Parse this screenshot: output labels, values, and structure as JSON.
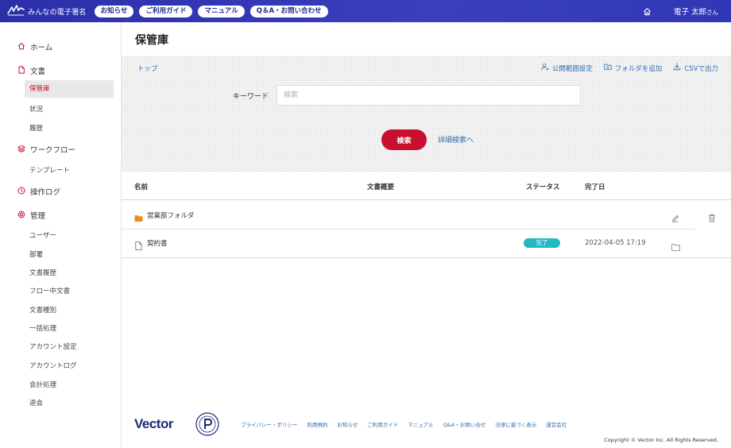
{
  "header": {
    "app_name": "みんなの電子署名",
    "nav": [
      "お知らせ",
      "ご利用ガイド",
      "マニュアル",
      "Q＆A・お問い合わせ"
    ],
    "user_name": "電子 太郎",
    "user_suffix": "さん"
  },
  "sidebar": {
    "home": "ホーム",
    "documents": "文書",
    "documents_sub": [
      "保管庫",
      "状況",
      "履歴"
    ],
    "workflow": "ワークフロー",
    "workflow_sub": [
      "テンプレート"
    ],
    "oplog": "操作ログ",
    "admin": "管理",
    "admin_sub": [
      "ユーザー",
      "部署",
      "文書履歴",
      "フロー中文書",
      "文書種別",
      "一括処理",
      "アカウント設定",
      "アカウントログ",
      "会計処理",
      "退会"
    ],
    "active_item": "保管庫"
  },
  "main": {
    "title": "保管庫",
    "breadcrumb": "トップ",
    "actions": [
      "公開範囲設定",
      "フォルダを追加",
      "CSVで出力"
    ],
    "keyword_label": "キーワード",
    "keyword_placeholder": "検索",
    "keyword_value": "",
    "search_button": "検索",
    "advanced_search_link": "詳細検索へ"
  },
  "table": {
    "columns": [
      "名前",
      "文書概要",
      "ステータス",
      "完了日"
    ],
    "rows": [
      {
        "type": "folder",
        "name": "営業部フォルダ",
        "summary": "",
        "status": "",
        "completed": ""
      },
      {
        "type": "file",
        "name": "契約書",
        "summary": "",
        "status": "完了",
        "completed": "2022-04-05 17:19"
      }
    ]
  },
  "footer": {
    "logo_text": "Vector",
    "links": [
      "プライバシー・ポリシー",
      "利用規約",
      "お知らせ",
      "ご利用ガイド",
      "マニュアル",
      "Q&A・お問い合せ",
      "法律に基づく表示",
      "運営会社"
    ],
    "copyright": "Copyright © Vector Inc. All Rights Reserved."
  },
  "colors": {
    "header_bg": "#3038b5",
    "accent_red": "#c8102e",
    "link_blue": "#2f6fb0",
    "status_teal": "#23b9c3",
    "folder_orange": "#e8901e"
  }
}
